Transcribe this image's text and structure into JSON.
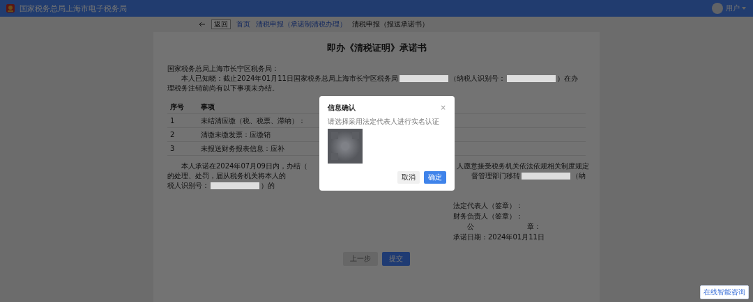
{
  "header": {
    "title": "国家税务总局上海市电子税务局",
    "user": "用户"
  },
  "breadcrumb": {
    "back": "返回",
    "items": [
      {
        "text": "首页",
        "link": true
      },
      {
        "text": "清税申报（承诺制清税办理）",
        "link": true
      },
      {
        "text": "清税申报（报送承诺书）",
        "link": false
      }
    ]
  },
  "document": {
    "title": "即办《清税证明》承诺书",
    "addressee": "国家税务总局上海市长宁区税务局：",
    "intro_lines": [
      [
        {
          "kind": "text",
          "text": "本人已知晓：截止2024年01月11日国家税务总局上海市长宁区税务局"
        },
        {
          "kind": "redacted"
        },
        {
          "kind": "text",
          "text": "（纳税人识别号："
        },
        {
          "kind": "redacted"
        },
        {
          "kind": "text",
          "text": "）在办"
        }
      ],
      [
        {
          "kind": "text",
          "text": "理税务注销前尚有以下事项未办结。"
        }
      ]
    ],
    "table": {
      "columns": [
        "序号",
        "事项"
      ],
      "rows": [
        {
          "index": "1",
          "text": "未结清应缴（税、税票、滞纳）："
        },
        {
          "index": "2",
          "text": "清缴未缴发票：应缴销"
        },
        {
          "index": "3",
          "text": "未报送财务报表信息：应补"
        }
      ]
    },
    "commitment_lines": [
      {
        "left": [
          {
            "kind": "text",
            "text": "本人承诺在2024年07月09日内，办结（"
          }
        ],
        "right": [
          {
            "kind": "text",
            "text": "人愿意接受税务机关依法依规相关制度规定"
          }
        ]
      },
      {
        "left": [
          {
            "kind": "text",
            "text": "的处理、处罚，届从税务机关将本人的"
          }
        ],
        "right": [
          {
            "kind": "text",
            "text": "督管理部门移转"
          },
          {
            "kind": "redacted"
          },
          {
            "kind": "text",
            "text": "（纳"
          }
        ]
      },
      {
        "left": [
          {
            "kind": "text",
            "text": "税人识别号："
          },
          {
            "kind": "redacted"
          },
          {
            "kind": "text",
            "text": "）的"
          }
        ]
      }
    ],
    "signatures": [
      {
        "kind": "line",
        "text": "法定代表人（签章）："
      },
      {
        "kind": "line",
        "text": "财务负责人（签章）："
      },
      {
        "kind": "split",
        "parts": [
          "公",
          "章："
        ]
      },
      {
        "kind": "line",
        "text": "承诺日期：2024年01月11日"
      }
    ]
  },
  "buttons": [
    {
      "label": "上一步",
      "disabled": true
    },
    {
      "label": "提交",
      "disabled": false
    }
  ],
  "dialog": {
    "title": "信息确认",
    "close": "×",
    "message": "请选择采用法定代表人进行实名认证",
    "buttons": [
      {
        "label": "取消",
        "kind": "secondary"
      },
      {
        "label": "确定",
        "kind": "primary"
      }
    ]
  },
  "help_button": "在线智能咨询"
}
